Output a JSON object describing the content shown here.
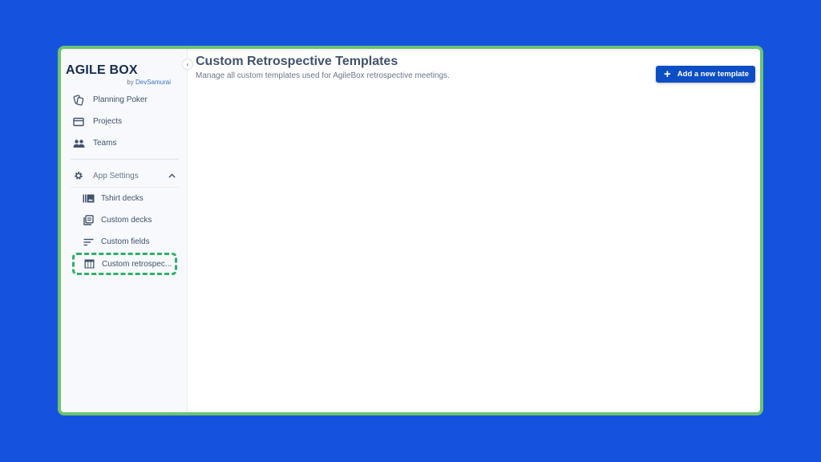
{
  "brand": {
    "title": "AGILE BOX",
    "by": "by",
    "company": "DevSamurai"
  },
  "sidebar": {
    "collapse_icon": "chevron-left-icon",
    "items": [
      {
        "label": "Planning Poker",
        "icon": "cards-icon"
      },
      {
        "label": "Projects",
        "icon": "window-icon"
      },
      {
        "label": "Teams",
        "icon": "people-icon"
      }
    ],
    "settings": {
      "label": "App Settings",
      "icon": "gear-icon",
      "expand_icon": "chevron-up-icon",
      "items": [
        {
          "label": "Tshirt decks",
          "icon": "tshirt-deck-icon"
        },
        {
          "label": "Custom decks",
          "icon": "deck-icon"
        },
        {
          "label": "Custom fields",
          "icon": "fields-icon"
        },
        {
          "label": "Custom retrospec...",
          "icon": "table-icon",
          "active": true
        }
      ]
    }
  },
  "main": {
    "title": "Custom Retrospective Templates",
    "description": "Manage all custom templates used for AgileBox retrospective meetings.",
    "add_button": {
      "label": "Add a new template",
      "icon": "plus-icon"
    }
  },
  "colors": {
    "background": "#1553de",
    "frame_border": "#6cc36f",
    "primary_button": "#0c4ec4",
    "highlight": "#2fb06a"
  }
}
